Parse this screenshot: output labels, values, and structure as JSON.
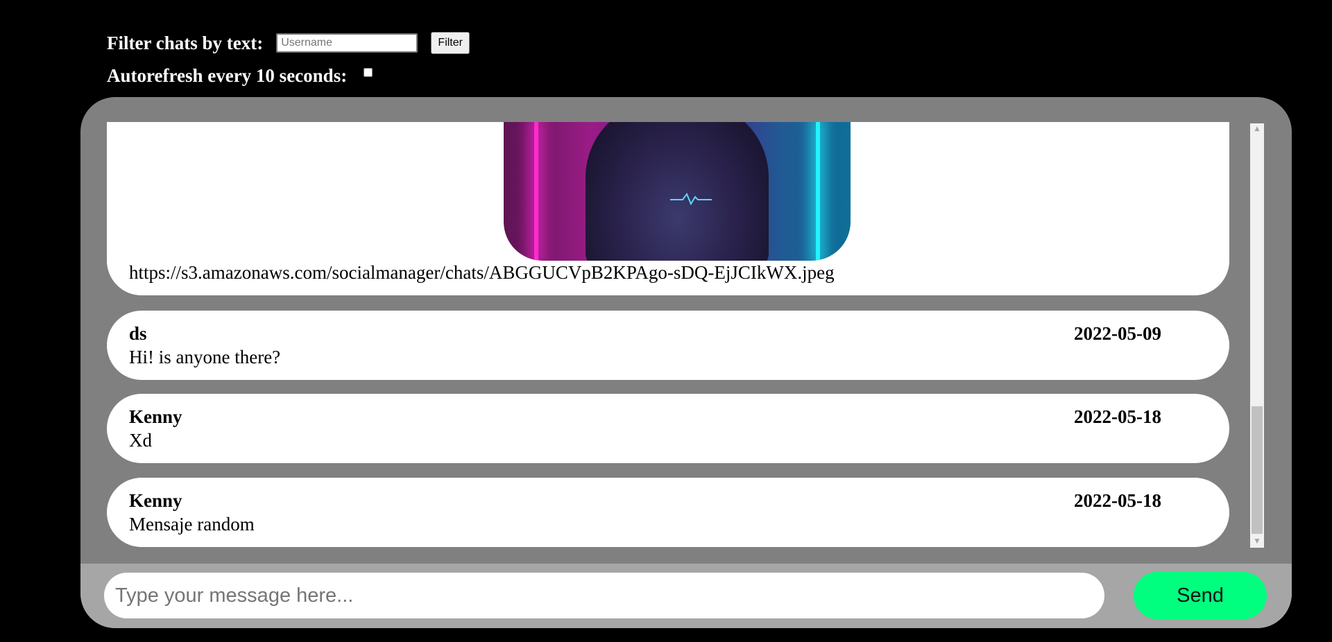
{
  "filter": {
    "label": "Filter chats by text:",
    "input_placeholder": "Username",
    "input_value": "",
    "button_label": "Filter"
  },
  "autorefresh": {
    "label": "Autorefresh every 10 seconds:",
    "checked": false
  },
  "messages": [
    {
      "type": "image",
      "url": "https://s3.amazonaws.com/socialmanager/chats/ABGGUCVpB2KPAgo-sDQ-EjJCIkWX.jpeg"
    },
    {
      "user": "ds",
      "date": "2022-05-09",
      "text": "Hi! is anyone there?"
    },
    {
      "user": "Kenny",
      "date": "2022-05-18",
      "text": "Xd"
    },
    {
      "user": "Kenny",
      "date": "2022-05-18",
      "text": "Mensaje random"
    }
  ],
  "composer": {
    "placeholder": "Type your message here...",
    "value": "",
    "send_label": "Send"
  },
  "colors": {
    "background": "#000000",
    "panel": "#808080",
    "composer_bar": "#a6a6a6",
    "send_button": "#00ff7f"
  }
}
